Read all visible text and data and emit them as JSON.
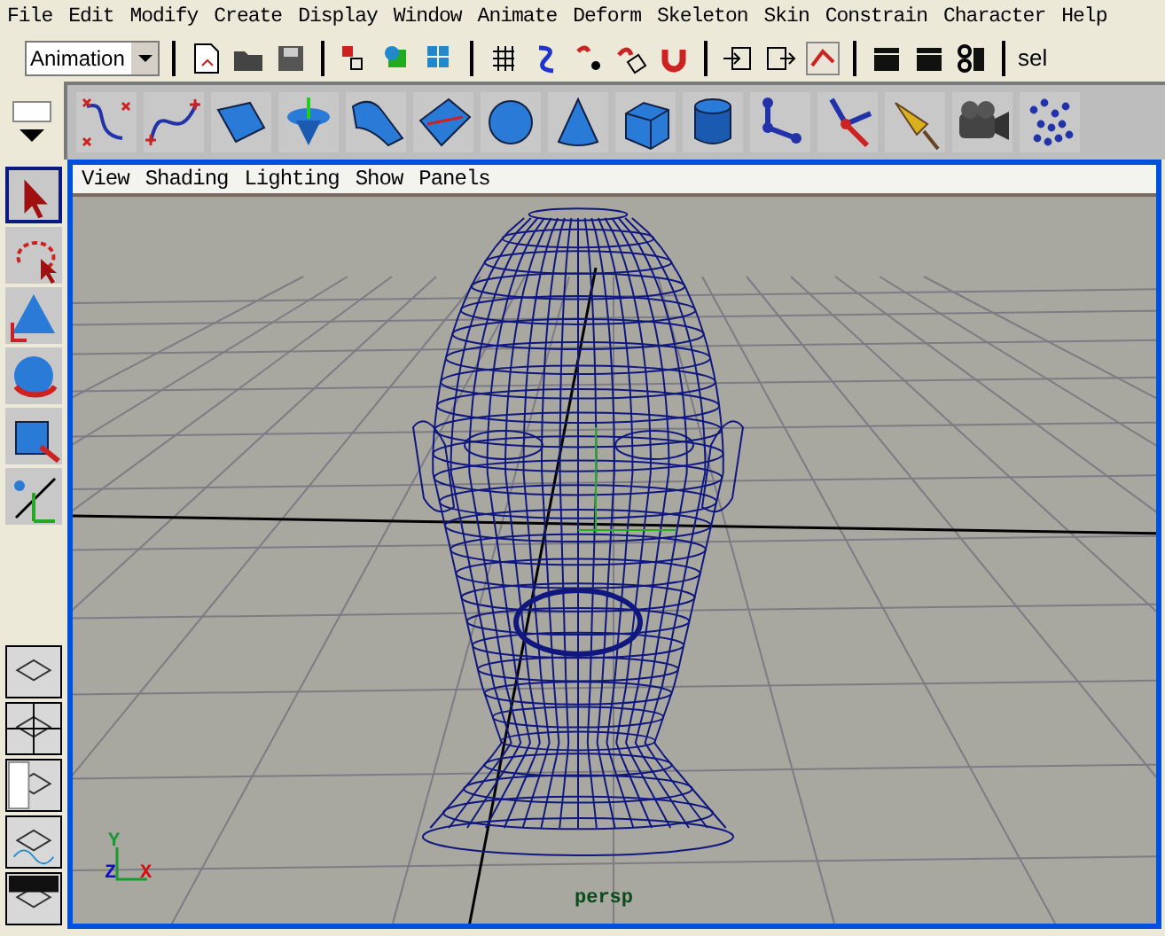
{
  "menubar": [
    "File",
    "Edit",
    "Modify",
    "Create",
    "Display",
    "Window",
    "Animate",
    "Deform",
    "Skeleton",
    "Skin",
    "Constrain",
    "Character",
    "Help"
  ],
  "mode_dropdown": {
    "value": "Animation"
  },
  "toolbar": {
    "truncated_label": "sel"
  },
  "viewport": {
    "menus": [
      "View",
      "Shading",
      "Lighting",
      "Show",
      "Panels"
    ],
    "camera_label": "persp",
    "axis_labels": [
      {
        "kind": "y",
        "text": "Y"
      },
      {
        "kind": "z",
        "text": "Z"
      },
      {
        "kind": "x",
        "text": "X"
      }
    ]
  }
}
